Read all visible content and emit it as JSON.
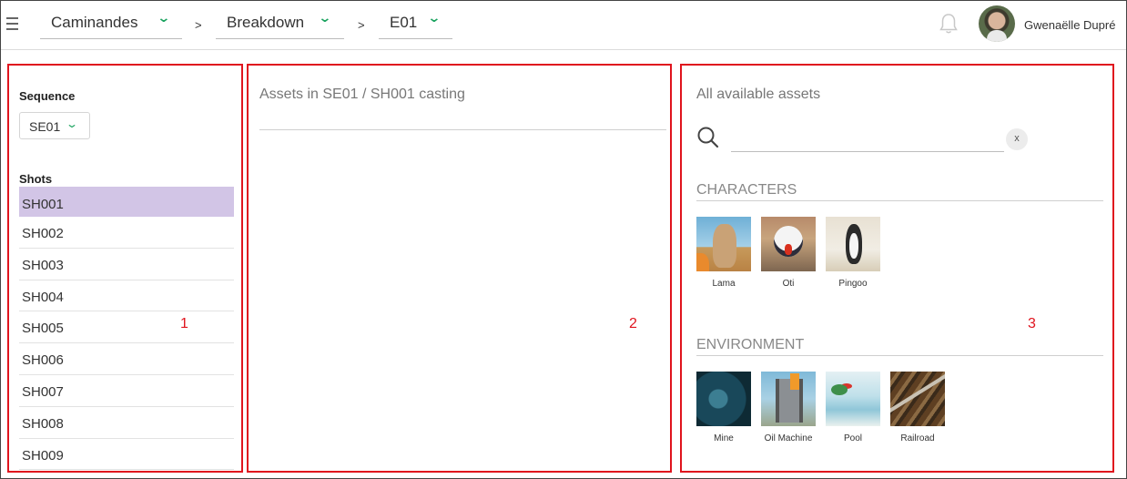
{
  "header": {
    "menu_icon": "hamburger-icon",
    "breadcrumbs": [
      {
        "label": "Caminandes"
      },
      {
        "label": "Breakdown"
      },
      {
        "label": "E01"
      }
    ],
    "separator": ">",
    "notification_icon": "bell-icon",
    "user": {
      "name": "Gwenaëlle Dupré"
    }
  },
  "annotations": {
    "panel1": "1",
    "panel2": "2",
    "panel3": "3"
  },
  "colors": {
    "accent": "#1aa35f",
    "selected_row": "#d2c5e6",
    "annotation": "#e0141e"
  },
  "sidebar": {
    "sequence_label": "Sequence",
    "sequence_value": "SE01",
    "shots_label": "Shots",
    "shots": [
      "SH001",
      "SH002",
      "SH003",
      "SH004",
      "SH005",
      "SH006",
      "SH007",
      "SH008",
      "SH009"
    ],
    "selected_shot": "SH001"
  },
  "casting": {
    "title": "Assets in SE01 / SH001 casting"
  },
  "library": {
    "title": "All available assets",
    "search": {
      "placeholder": "",
      "value": "",
      "clear_label": "x"
    },
    "categories": [
      {
        "title": "CHARACTERS",
        "assets": [
          "Lama",
          "Oti",
          "Pingoo"
        ]
      },
      {
        "title": "ENVIRONMENT",
        "assets": [
          "Mine",
          "Oil Machine",
          "Pool",
          "Railroad"
        ]
      }
    ]
  }
}
